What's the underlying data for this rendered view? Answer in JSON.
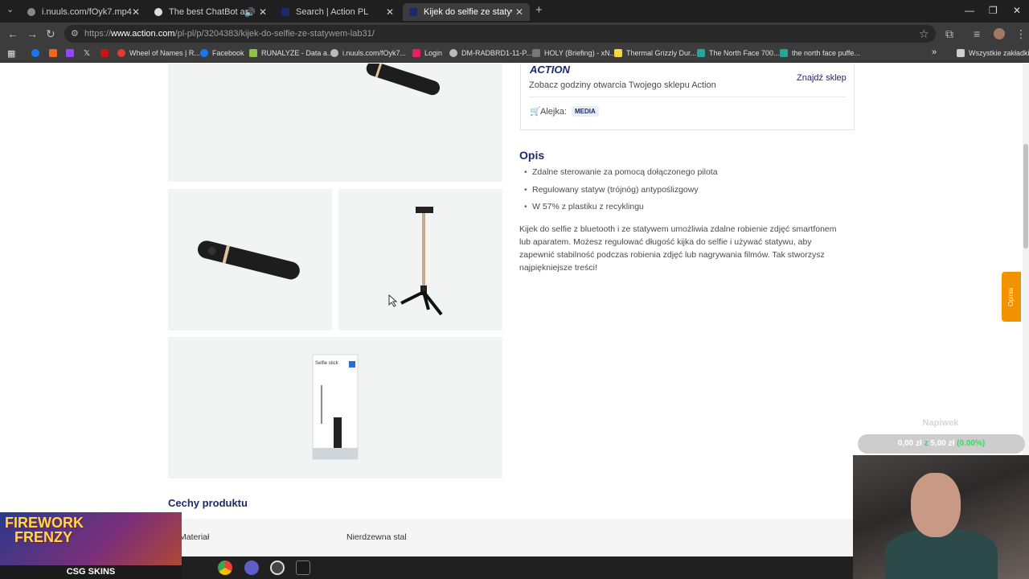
{
  "browser": {
    "tabs": [
      {
        "title": "i.nuuls.com/fOyk7.mp4",
        "active": false
      },
      {
        "title": "The best ChatBot and Widg",
        "active": false
      },
      {
        "title": "Search | Action PL",
        "active": false
      },
      {
        "title": "Kijek do selfie ze statywem Lab",
        "active": true
      }
    ],
    "url_prefix": "https://",
    "url_host": "www.action.com",
    "url_path": "/pl-pl/p/3204383/kijek-do-selfie-ze-statywem-lab31/",
    "bookmarks": [
      "Wheel of Names | R...",
      "Facebook",
      "RUNALYZE - Data a...",
      "i.nuuls.com/fOyk7...",
      "Login",
      "DM-RADBRD1-11-P...",
      "HOLY (Briefing) - xN...",
      "Thermal Grizzly Dur...",
      "The North Face 700...",
      "the north face puffe...",
      "Wszystkie zakładki"
    ]
  },
  "store": {
    "logo": "ACTION",
    "hours_text": "Zobacz godziny otwarcia Twojego sklepu Action",
    "find_store": "Znajdź sklep",
    "aisle_label": "Alejka:",
    "aisle_value": "MEDIA"
  },
  "description": {
    "heading": "Opis",
    "bullets": [
      "Zdalne sterowanie za pomocą dołączonego pilota",
      "Regulowany statyw (trójnóg) antypoślizgowy",
      "W 57% z plastiku z recyklingu"
    ],
    "paragraph": "Kijek do selfie z bluetooth i ze statywem umożliwia zdalne robienie zdjęć smartfonem lub aparatem. Możesz regulować długość kijka do selfie i używać statywu, aby zapewnić stabilność podczas robienia zdjęć lub nagrywania filmów. Tak stworzysz najpiękniejsze treści!"
  },
  "features": {
    "heading": "Cechy produktu",
    "rows": [
      {
        "label": "Materiał",
        "value": "Nierdzewna stal"
      }
    ]
  },
  "feedback_tab": "Opinia",
  "package_text": "Selfie stick",
  "overlay": {
    "game_title_1": "FIREWORK",
    "game_title_2": "FRENZY",
    "brand": "CSG SKINS",
    "donation_label": "Napiwek",
    "donation_amount": "0,00 zł",
    "donation_sep": "z",
    "donation_goal": "5,00 zł",
    "donation_pct": "(0.00%)"
  },
  "colors": {
    "action_navy": "#1c2a6b",
    "feedback_orange": "#f29200",
    "donation_green": "#2ee05a"
  }
}
